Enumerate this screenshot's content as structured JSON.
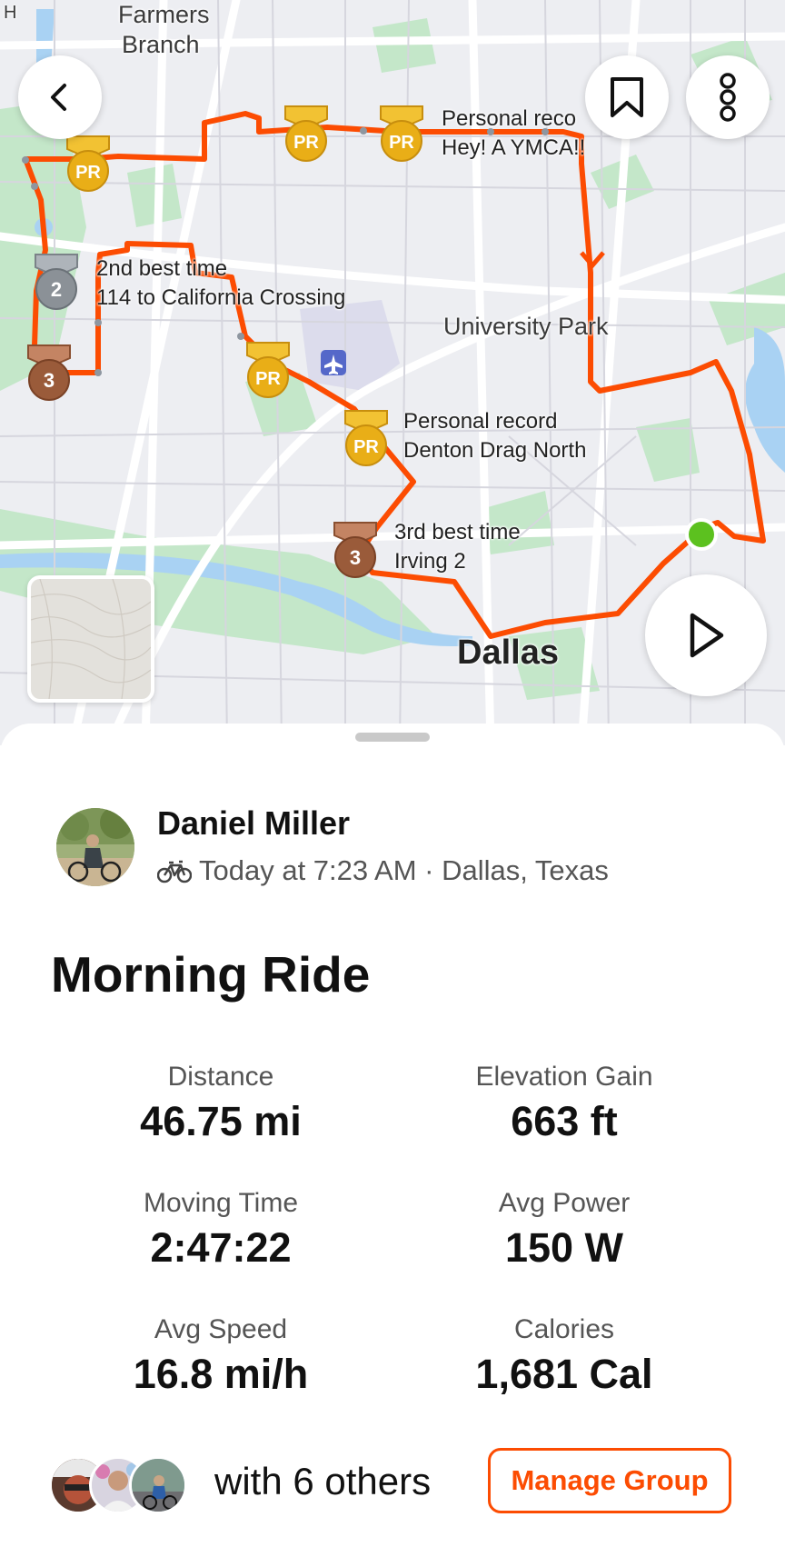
{
  "map": {
    "place_labels": {
      "farmers_branch_1": "Farmers",
      "farmers_branch_2": "Branch",
      "university_park": "University Park",
      "corner": "H"
    },
    "city_label": "Dallas",
    "segment_labels": {
      "ymca_title": "Personal reco",
      "ymca_name": "Hey! A YMCA!!",
      "california_title": "2nd best time",
      "california_name": "114 to California Crossing",
      "denton_title": "Personal record",
      "denton_name": "Denton Drag North",
      "irving_title": "3rd best time",
      "irving_name": "Irving 2"
    },
    "badges": {
      "pr": "PR",
      "second": "2",
      "third": "3"
    },
    "route_color": "#fc4c02",
    "start_color": "#5cc11f"
  },
  "icons": {
    "back": "chevron-left-icon",
    "bookmark": "bookmark-icon",
    "more": "more-vertical-icon",
    "play": "play-icon",
    "sport": "bicycle-icon"
  },
  "activity": {
    "athlete_name": "Daniel Miller",
    "meta": "Today at 7:23 AM · Dallas, Texas",
    "title": "Morning Ride"
  },
  "stats": {
    "distance": {
      "label": "Distance",
      "value": "46.75 mi"
    },
    "elevation": {
      "label": "Elevation Gain",
      "value": "663 ft"
    },
    "moving_time": {
      "label": "Moving Time",
      "value": "2:47:22"
    },
    "avg_power": {
      "label": "Avg Power",
      "value": "150 W"
    },
    "avg_speed": {
      "label": "Avg Speed",
      "value": "16.8 mi/h"
    },
    "calories": {
      "label": "Calories",
      "value": "1,681 Cal"
    }
  },
  "group": {
    "others_text": "with 6 others",
    "manage_label": "Manage Group"
  },
  "colors": {
    "accent": "#fc4c02",
    "pr_gold": "#e6a817",
    "silver": "#8b9197",
    "bronze": "#9a5b3a"
  }
}
